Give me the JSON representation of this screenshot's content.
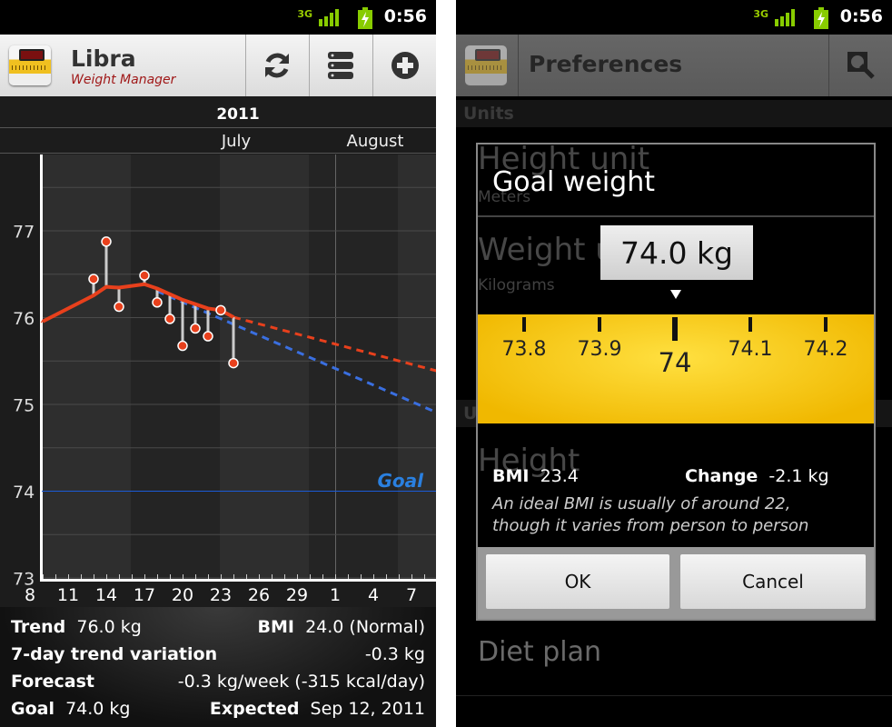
{
  "status_bar": {
    "time": "0:56",
    "network": "3G",
    "icons": [
      "3g-data-icon",
      "signal-icon",
      "battery-charging-icon"
    ]
  },
  "left": {
    "app_title": "Libra",
    "app_subtitle": "Weight Manager",
    "actions": [
      {
        "icon": "refresh-icon"
      },
      {
        "icon": "list-icon"
      },
      {
        "icon": "add-icon"
      }
    ],
    "stats": {
      "trend_label": "Trend",
      "trend_value": "76.0 kg",
      "bmi_label": "BMI",
      "bmi_value": "24.0 (Normal)",
      "variation_label": "7-day trend variation",
      "variation_value": "-0.3 kg",
      "forecast_label": "Forecast",
      "forecast_value": "-0.3 kg/week (-315 kcal/day)",
      "goal_label": "Goal",
      "goal_value": "74.0 kg",
      "expected_label": "Expected",
      "expected_value": "Sep 12, 2011"
    }
  },
  "chart_data": {
    "type": "line",
    "year_label": "2011",
    "month_labels": [
      "July",
      "August"
    ],
    "x_tick_labels": [
      "8",
      "11",
      "14",
      "17",
      "20",
      "23",
      "26",
      "29",
      "1",
      "4",
      "7"
    ],
    "y_tick_labels": [
      "73",
      "74",
      "75",
      "76",
      "77"
    ],
    "ylim": [
      73,
      77.6
    ],
    "grid": true,
    "goal": {
      "label": "Goal",
      "value": 74.0,
      "color": "#1a5ad8"
    },
    "weights": [
      {
        "date": "2011-07-13",
        "value": 76.44
      },
      {
        "date": "2011-07-14",
        "value": 76.87
      },
      {
        "date": "2011-07-15",
        "value": 76.12
      },
      {
        "date": "2011-07-17",
        "value": 76.48
      },
      {
        "date": "2011-07-18",
        "value": 76.17
      },
      {
        "date": "2011-07-19",
        "value": 75.98
      },
      {
        "date": "2011-07-20",
        "value": 75.67
      },
      {
        "date": "2011-07-21",
        "value": 75.87
      },
      {
        "date": "2011-07-22",
        "value": 75.78
      },
      {
        "date": "2011-07-23",
        "value": 76.08
      },
      {
        "date": "2011-07-24",
        "value": 75.47
      }
    ],
    "trend": [
      {
        "date": "2011-07-09",
        "value": 75.95
      },
      {
        "date": "2011-07-13",
        "value": 76.25
      },
      {
        "date": "2011-07-14",
        "value": 76.35
      },
      {
        "date": "2011-07-15",
        "value": 76.34
      },
      {
        "date": "2011-07-17",
        "value": 76.38
      },
      {
        "date": "2011-07-18",
        "value": 76.33
      },
      {
        "date": "2011-07-20",
        "value": 76.2
      },
      {
        "date": "2011-07-22",
        "value": 76.1
      },
      {
        "date": "2011-07-23",
        "value": 76.08
      },
      {
        "date": "2011-07-24",
        "value": 76.0
      }
    ],
    "forecast_trend": [
      {
        "date": "2011-07-24",
        "value": 76.0
      },
      {
        "date": "2011-08-09",
        "value": 75.38
      }
    ],
    "forecast_weekly": [
      {
        "date": "2011-07-18",
        "value": 76.3
      },
      {
        "date": "2011-08-09",
        "value": 74.9
      }
    ],
    "colors": {
      "trend": "#e8401c",
      "weight_point": "#e8401c",
      "forecast_trend": "#e8401c",
      "forecast_weekly": "#3a6fe0"
    }
  },
  "right": {
    "title": "Preferences",
    "action_icon": "wrench-icon",
    "background": {
      "section1": "Units",
      "height_unit": "Height unit",
      "height_unit_value": "Meters",
      "weight_unit": "Weight unit",
      "weight_unit_value": "Kilograms",
      "section2": "U",
      "height": "Height",
      "diet_plan": "Diet plan"
    },
    "dialog": {
      "title": "Goal weight",
      "value": "74.0 kg",
      "ruler": [
        "73.8",
        "73.9",
        "74",
        "74.1",
        "74.2"
      ],
      "bmi_label": "BMI",
      "bmi_value": "23.4",
      "change_label": "Change",
      "change_value": "-2.1 kg",
      "note_line1": "An ideal BMI is usually of around 22,",
      "note_line2": "though it varies from person to person",
      "ok": "OK",
      "cancel": "Cancel"
    }
  }
}
